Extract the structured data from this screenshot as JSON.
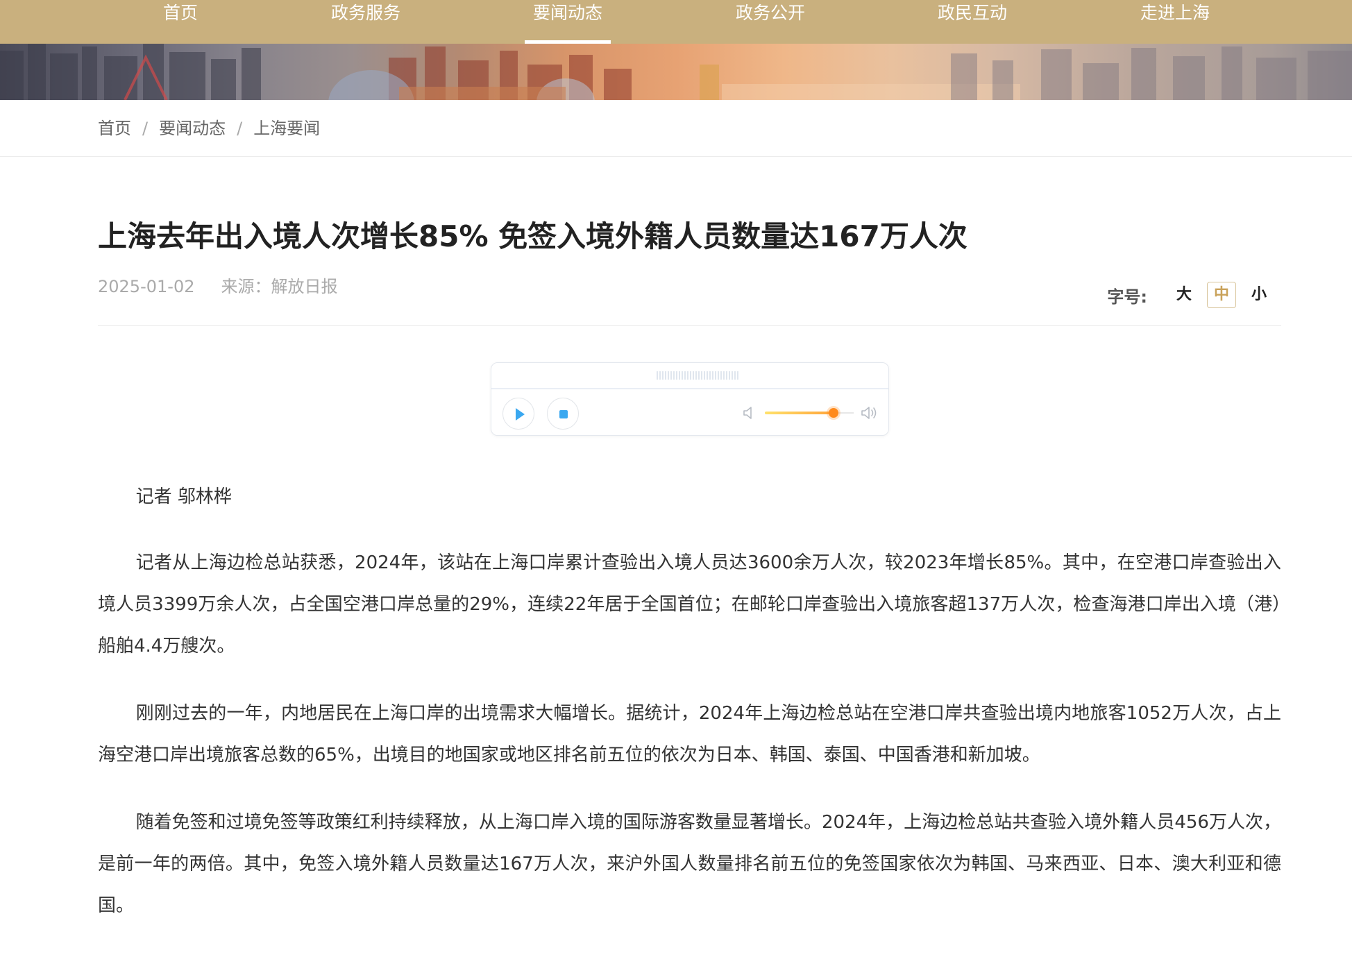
{
  "nav": {
    "items": [
      {
        "label": "首页",
        "active": false
      },
      {
        "label": "政务服务",
        "active": false
      },
      {
        "label": "要闻动态",
        "active": true
      },
      {
        "label": "政务公开",
        "active": false
      },
      {
        "label": "政民互动",
        "active": false
      },
      {
        "label": "走进上海",
        "active": false
      }
    ]
  },
  "breadcrumb": {
    "items": [
      "首页",
      "要闻动态",
      "上海要闻"
    ],
    "separator": "/"
  },
  "article": {
    "title": "上海去年出入境人次增长85% 免签入境外籍人员数量达167万人次",
    "date": "2025-01-02",
    "source": "来源：解放日报",
    "paragraphs": [
      "记者 邬林桦",
      "记者从上海边检总站获悉，2024年，该站在上海口岸累计查验出入境人员达3600余万人次，较2023年增长85%。其中，在空港口岸查验出入境人员3399万余人次，占全国空港口岸总量的29%，连续22年居于全国首位；在邮轮口岸查验出入境旅客超137万人次，检查海港口岸出入境（港）船舶4.4万艘次。",
      "刚刚过去的一年，内地居民在上海口岸的出境需求大幅增长。据统计，2024年上海边检总站在空港口岸共查验出境内地旅客1052万人次，占上海空港口岸出境旅客总数的65%，出境目的地国家或地区排名前五位的依次为日本、韩国、泰国、中国香港和新加坡。",
      "随着免签和过境免签等政策红利持续释放，从上海口岸入境的国际游客数量显著增长。2024年，上海边检总站共查验入境外籍人员456万人次，是前一年的两倍。其中，免签入境外籍人员数量达167万人次，来沪外国人数量排名前五位的免签国家依次为韩国、马来西亚、日本、澳大利亚和德国。"
    ]
  },
  "font_size": {
    "label": "字号:",
    "options": [
      "大",
      "中",
      "小"
    ],
    "selected": "中"
  },
  "player": {
    "volume": 0.77,
    "icons": [
      "play-icon",
      "stop-icon",
      "volume-low-icon",
      "volume-high-icon"
    ]
  },
  "colors": {
    "nav_bg": "#c9b07e",
    "player_accent": "#3aa8f0",
    "volume_accent": "#ff8a1c",
    "font_active": "#c9a25a"
  }
}
